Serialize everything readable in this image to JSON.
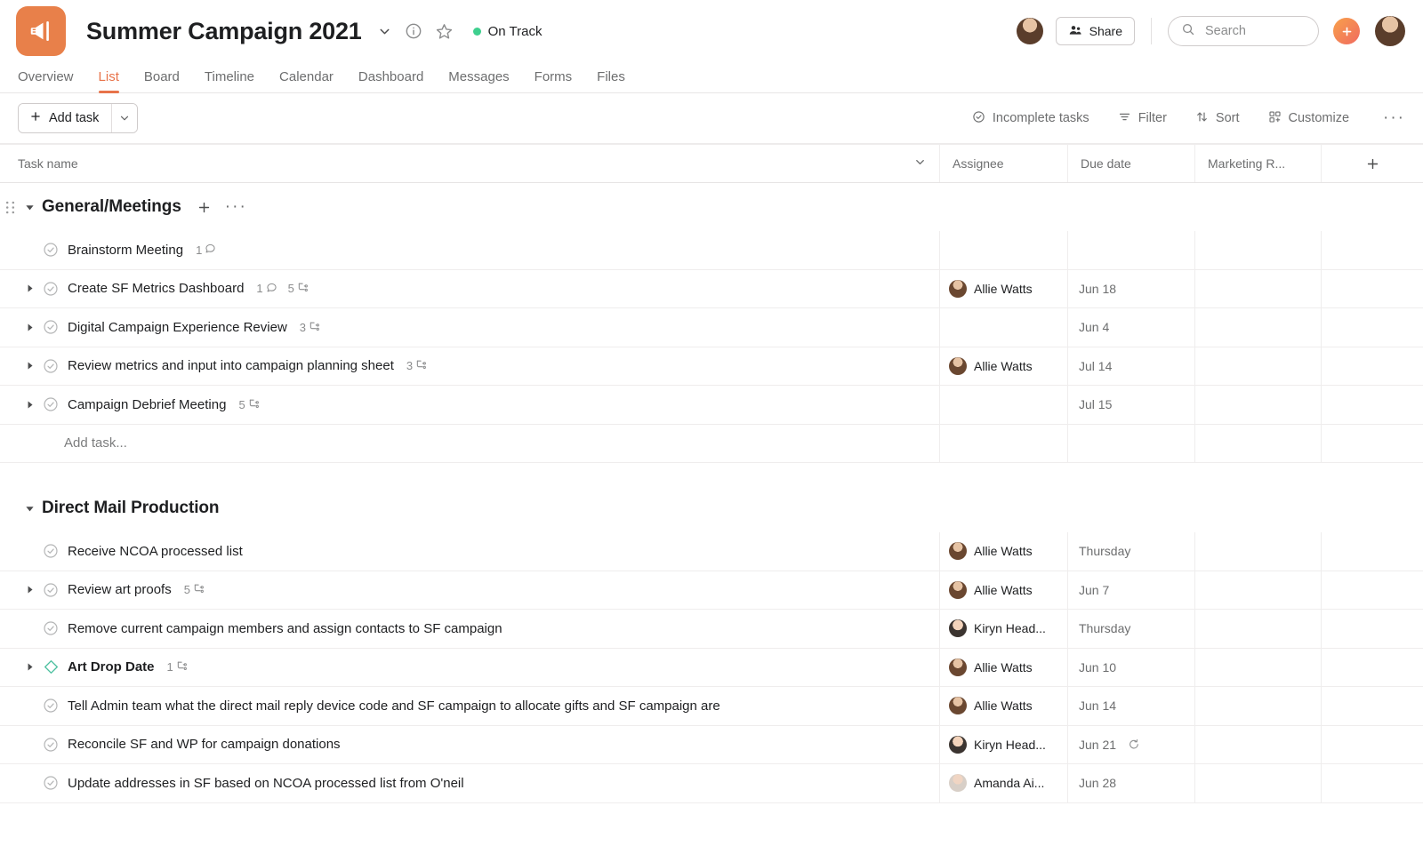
{
  "header": {
    "project_icon": "megaphone-icon",
    "project_icon_color": "#e8804a",
    "title": "Summer Campaign 2021",
    "caret_icon": "chevron-down-icon",
    "info_icon": "info-circle-icon",
    "star_icon": "star-icon",
    "status": "On Track",
    "status_color": "#3ecf8e",
    "share_label": "Share",
    "share_icon": "people-icon",
    "search_placeholder": "Search",
    "search_icon": "search-icon",
    "plus_icon": "plus-icon",
    "plus_color": "#f0745a"
  },
  "tabs": [
    {
      "label": "Overview",
      "active": false
    },
    {
      "label": "List",
      "active": true
    },
    {
      "label": "Board",
      "active": false
    },
    {
      "label": "Timeline",
      "active": false
    },
    {
      "label": "Calendar",
      "active": false
    },
    {
      "label": "Dashboard",
      "active": false
    },
    {
      "label": "Messages",
      "active": false
    },
    {
      "label": "Forms",
      "active": false
    },
    {
      "label": "Files",
      "active": false
    }
  ],
  "tab_accent_color": "#e8734a",
  "toolbar": {
    "add_task_label": "Add task",
    "add_task_plus_icon": "plus-icon",
    "add_task_caret_icon": "chevron-down-icon",
    "incomplete_label": "Incomplete tasks",
    "incomplete_icon": "check-circle-icon",
    "filter_label": "Filter",
    "filter_icon": "filter-icon",
    "sort_label": "Sort",
    "sort_icon": "sort-arrows-icon",
    "customize_label": "Customize",
    "customize_icon": "customize-grid-icon",
    "more_label": "···"
  },
  "columns": {
    "name": "Task name",
    "name_caret_icon": "chevron-down-icon",
    "assignee": "Assignee",
    "due_date": "Due date",
    "marketing": "Marketing R...",
    "add_column_icon": "plus-icon"
  },
  "sections": [
    {
      "title": "General/Meetings",
      "caret_icon": "caret-down-icon",
      "drag_handle_icon": "drag-dots-icon",
      "add_icon": "plus-icon",
      "more_icon": "ellipsis-icon",
      "has_drag_handle": true,
      "has_actions": true,
      "add_task_placeholder": "Add task...",
      "tasks": [
        {
          "name": "Brainstorm Meeting",
          "expandable": false,
          "milestone": false,
          "comments": "1",
          "subtasks": "",
          "assignee": "",
          "avatar_class": "",
          "due": "",
          "repeat": false
        },
        {
          "name": "Create SF Metrics Dashboard",
          "expandable": true,
          "milestone": false,
          "comments": "1",
          "subtasks": "5",
          "assignee": "Allie Watts",
          "avatar_class": "av-allie",
          "due": "Jun 18",
          "repeat": false
        },
        {
          "name": "Digital Campaign Experience Review",
          "expandable": true,
          "milestone": false,
          "comments": "",
          "subtasks": "3",
          "assignee": "",
          "avatar_class": "",
          "due": "Jun 4",
          "repeat": false
        },
        {
          "name": "Review metrics and input into campaign planning sheet",
          "expandable": true,
          "milestone": false,
          "comments": "",
          "subtasks": "3",
          "assignee": "Allie Watts",
          "avatar_class": "av-allie",
          "due": "Jul 14",
          "repeat": false
        },
        {
          "name": "Campaign Debrief Meeting",
          "expandable": true,
          "milestone": false,
          "comments": "",
          "subtasks": "5",
          "assignee": "",
          "avatar_class": "",
          "due": "Jul 15",
          "repeat": false
        }
      ]
    },
    {
      "title": "Direct Mail Production",
      "caret_icon": "caret-down-icon",
      "drag_handle_icon": "",
      "add_icon": "",
      "more_icon": "",
      "has_drag_handle": false,
      "has_actions": false,
      "add_task_placeholder": "",
      "tasks": [
        {
          "name": "Receive NCOA processed list",
          "expandable": false,
          "milestone": false,
          "comments": "",
          "subtasks": "",
          "assignee": "Allie Watts",
          "avatar_class": "av-allie",
          "due": "Thursday",
          "repeat": false
        },
        {
          "name": "Review art proofs",
          "expandable": true,
          "milestone": false,
          "comments": "",
          "subtasks": "5",
          "assignee": "Allie Watts",
          "avatar_class": "av-allie",
          "due": "Jun 7",
          "repeat": false
        },
        {
          "name": "Remove current campaign members and assign contacts to SF campaign",
          "expandable": false,
          "milestone": false,
          "comments": "",
          "subtasks": "",
          "assignee": "Kiryn Head...",
          "avatar_class": "av-kiryn",
          "due": "Thursday",
          "repeat": false
        },
        {
          "name": "Art Drop Date",
          "expandable": true,
          "milestone": true,
          "comments": "",
          "subtasks": "1",
          "assignee": "Allie Watts",
          "avatar_class": "av-allie",
          "due": "Jun 10",
          "repeat": false
        },
        {
          "name": "Tell Admin team what the direct mail reply device code and SF campaign to allocate gifts and SF campaign are",
          "expandable": false,
          "milestone": false,
          "comments": "",
          "subtasks": "",
          "assignee": "Allie Watts",
          "avatar_class": "av-allie",
          "due": "Jun 14",
          "repeat": false
        },
        {
          "name": "Reconcile SF and WP for campaign donations",
          "expandable": false,
          "milestone": false,
          "comments": "",
          "subtasks": "",
          "assignee": "Kiryn Head...",
          "avatar_class": "av-kiryn",
          "due": "Jun 21",
          "repeat": true
        },
        {
          "name": "Update addresses in SF based on NCOA processed list from O'neil",
          "expandable": false,
          "milestone": false,
          "comments": "",
          "subtasks": "",
          "assignee": "Amanda Ai...",
          "avatar_class": "av-amanda",
          "due": "Jun 28",
          "repeat": false
        }
      ]
    }
  ],
  "milestone_color": "#4ec0a0"
}
